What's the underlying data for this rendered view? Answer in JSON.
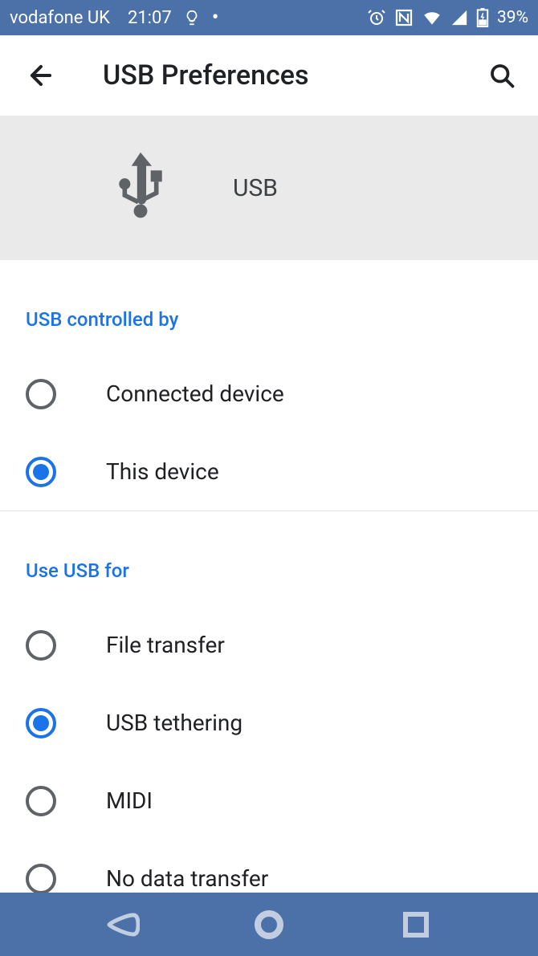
{
  "status": {
    "carrier": "vodafone UK",
    "time": "21:07",
    "battery": "39%"
  },
  "appBar": {
    "title": "USB Preferences"
  },
  "usbHeader": {
    "label": "USB"
  },
  "sections": {
    "controlledBy": {
      "header": "USB controlled by",
      "options": [
        {
          "label": "Connected device",
          "selected": false
        },
        {
          "label": "This device",
          "selected": true
        }
      ]
    },
    "useFor": {
      "header": "Use USB for",
      "options": [
        {
          "label": "File transfer",
          "selected": false
        },
        {
          "label": "USB tethering",
          "selected": true
        },
        {
          "label": "MIDI",
          "selected": false
        },
        {
          "label": "No data transfer",
          "selected": false
        }
      ]
    }
  },
  "colors": {
    "accent": "#1a73e8",
    "statusBar": "#4c71a9"
  }
}
